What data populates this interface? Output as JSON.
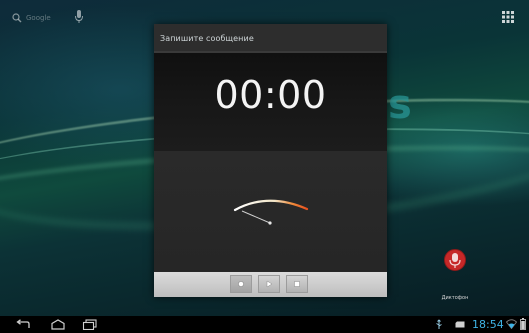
{
  "home": {
    "search_label": "Google",
    "icons": {
      "search": "search-icon",
      "mic": "mic-icon",
      "apps": "apps-icon"
    },
    "shortcut": {
      "label": "Диктофон",
      "icon": "microphone-recorder-icon"
    }
  },
  "dialog": {
    "title": "Запишите сообщение",
    "timer": "00:00",
    "meter_icon": "vu-meter-icon",
    "controls": {
      "record": "record-icon",
      "play": "play-icon",
      "stop": "stop-icon"
    }
  },
  "status_bar": {
    "clock": "18:54",
    "icons": [
      "usb-icon",
      "sd-card-icon",
      "wifi-icon",
      "battery-icon"
    ]
  },
  "navigation": {
    "icons": [
      "back-icon",
      "home-icon",
      "recent-apps-icon"
    ]
  },
  "colors": {
    "clock_accent": "#3fb3e6",
    "meter_arc_start": "#ffffff",
    "meter_arc_end": "#e8501e",
    "recorder_icon": "#c62828"
  }
}
